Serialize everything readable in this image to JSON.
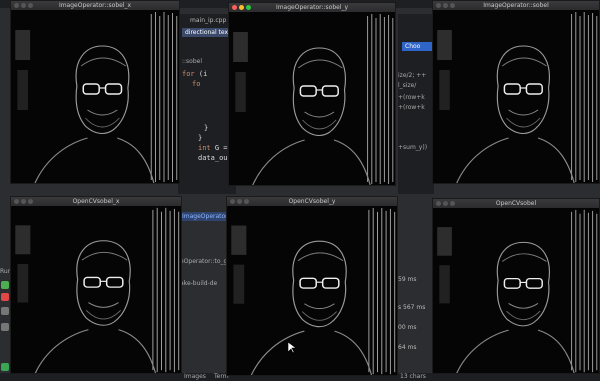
{
  "ide": {
    "code_lines": [
      {
        "pre": "",
        "kw": "for",
        "rest": " (i"
      },
      {
        "pre": "  ",
        "kw": "fo",
        "rest": ""
      },
      {
        "pre": "",
        "kw": "",
        "rest": "}"
      },
      {
        "pre": "",
        "kw": "",
        "rest": "}"
      },
      {
        "pre": "",
        "kw": "int",
        "rest": " G ="
      },
      {
        "pre": "",
        "kw": "",
        "rest": "data_ou"
      }
    ],
    "file_chip": "main_ip.cpp",
    "tab_chip": "directional text",
    "sobel_label": "::sobel",
    "breadcrumb": "ImageOperator",
    "func_hint": "eOperator::to_g",
    "build_hint": "ake-build-de",
    "right_lines": [
      "ize/2; ++",
      "l_size/",
      "+(row+k",
      "+(row+k",
      "",
      "+sum_y))"
    ],
    "choose_button": "Choo",
    "timings": [
      "59 ms",
      "s 567 ms",
      "00 ms",
      "64 ms"
    ],
    "run_label": "Run",
    "status_left": "Images",
    "status_term": "Term",
    "status_right": "13 chars"
  },
  "windows": [
    {
      "id": "img-sobel-x",
      "title": "ImageOperator::sobel_x"
    },
    {
      "id": "img-sobel-y",
      "title": "ImageOperator::sobel_y"
    },
    {
      "id": "img-sobel",
      "title": "ImageOperator::sobel"
    },
    {
      "id": "cv-sobel-x",
      "title": "OpenCVsobel_x"
    },
    {
      "id": "cv-sobel-y",
      "title": "OpenCVsobel_y"
    },
    {
      "id": "cv-sobel",
      "title": "OpenCVsobel"
    }
  ],
  "colors": {
    "close": "#ff5f57",
    "minimize": "#febc2e",
    "zoom": "#28c840",
    "accent": "#2f64c8"
  }
}
